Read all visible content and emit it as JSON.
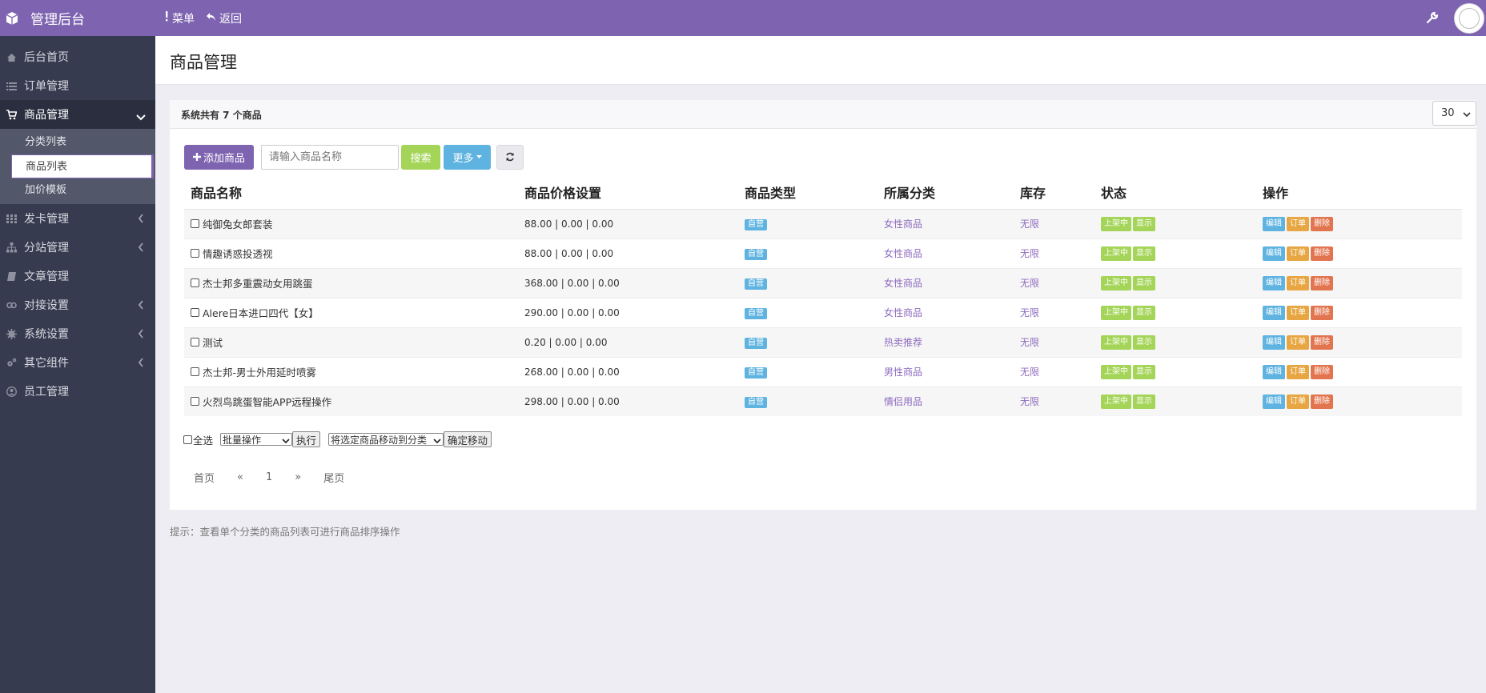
{
  "app": {
    "title": "管理后台"
  },
  "topnav": {
    "menu": "菜单",
    "back": "返回"
  },
  "sidebar": {
    "items": [
      {
        "label": "后台首页",
        "icon": "home-icon"
      },
      {
        "label": "订单管理",
        "icon": "list-icon"
      },
      {
        "label": "商品管理",
        "icon": "cart-icon"
      },
      {
        "label": "发卡管理",
        "icon": "grid-icon"
      },
      {
        "label": "分站管理",
        "icon": "sitemap-icon"
      },
      {
        "label": "文章管理",
        "icon": "book-icon"
      },
      {
        "label": "对接设置",
        "icon": "link-icon"
      },
      {
        "label": "系统设置",
        "icon": "gear-icon"
      },
      {
        "label": "其它组件",
        "icon": "cogs-icon"
      },
      {
        "label": "员工管理",
        "icon": "user-icon"
      }
    ],
    "sub": [
      {
        "label": "分类列表"
      },
      {
        "label": "商品列表"
      },
      {
        "label": "加价模板"
      }
    ]
  },
  "page": {
    "title": "商品管理"
  },
  "panel": {
    "count_text": "系统共有 7 个商品",
    "per_page": "30"
  },
  "toolbar": {
    "add": "添加商品",
    "search_placeholder": "请输入商品名称",
    "search": "搜索",
    "more": "更多"
  },
  "table": {
    "headers": [
      "商品名称",
      "商品价格设置",
      "商品类型",
      "所属分类",
      "库存",
      "状态",
      "操作"
    ],
    "rows": [
      {
        "name": "纯御兔女郎套装",
        "price": "88.00 | 0.00 | 0.00",
        "type": "自营",
        "category": "女性商品",
        "stock": "无限"
      },
      {
        "name": "情趣诱惑投透视",
        "price": "88.00 | 0.00 | 0.00",
        "type": "自营",
        "category": "女性商品",
        "stock": "无限"
      },
      {
        "name": "杰士邦多重震动女用跳蛋",
        "price": "368.00 | 0.00 | 0.00",
        "type": "自营",
        "category": "女性商品",
        "stock": "无限"
      },
      {
        "name": "Alere日本进口四代【女】",
        "price": "290.00 | 0.00 | 0.00",
        "type": "自营",
        "category": "女性商品",
        "stock": "无限"
      },
      {
        "name": "测试",
        "price": "0.20 | 0.00 | 0.00",
        "type": "自营",
        "category": "热卖推荐",
        "stock": "无限"
      },
      {
        "name": "杰士邦-男士外用延时喷雾",
        "price": "268.00 | 0.00 | 0.00",
        "type": "自营",
        "category": "男性商品",
        "stock": "无限"
      },
      {
        "name": "火烈鸟跳蛋智能APP远程操作",
        "price": "298.00 | 0.00 | 0.00",
        "type": "自营",
        "category": "情侣用品",
        "stock": "无限"
      }
    ],
    "status_on": "上架中",
    "status_show": "显示",
    "op_edit": "编辑",
    "op_order": "订单",
    "op_delete": "删除"
  },
  "batch": {
    "select_all": "全选",
    "batch_op": "批量操作",
    "execute": "执行",
    "move_to": "将选定商品移动到分类",
    "confirm_move": "确定移动"
  },
  "pager": {
    "first": "首页",
    "prev": "«",
    "page": "1",
    "next": "»",
    "last": "尾页"
  },
  "hint": "提示：查看单个分类的商品列表可进行商品排序操作",
  "colors": {
    "primary": "#7e63b0",
    "sidebar": "#363b50",
    "green": "#a4d559",
    "blue": "#5fb3e0",
    "orange": "#e7a642",
    "red": "#e2754f"
  }
}
